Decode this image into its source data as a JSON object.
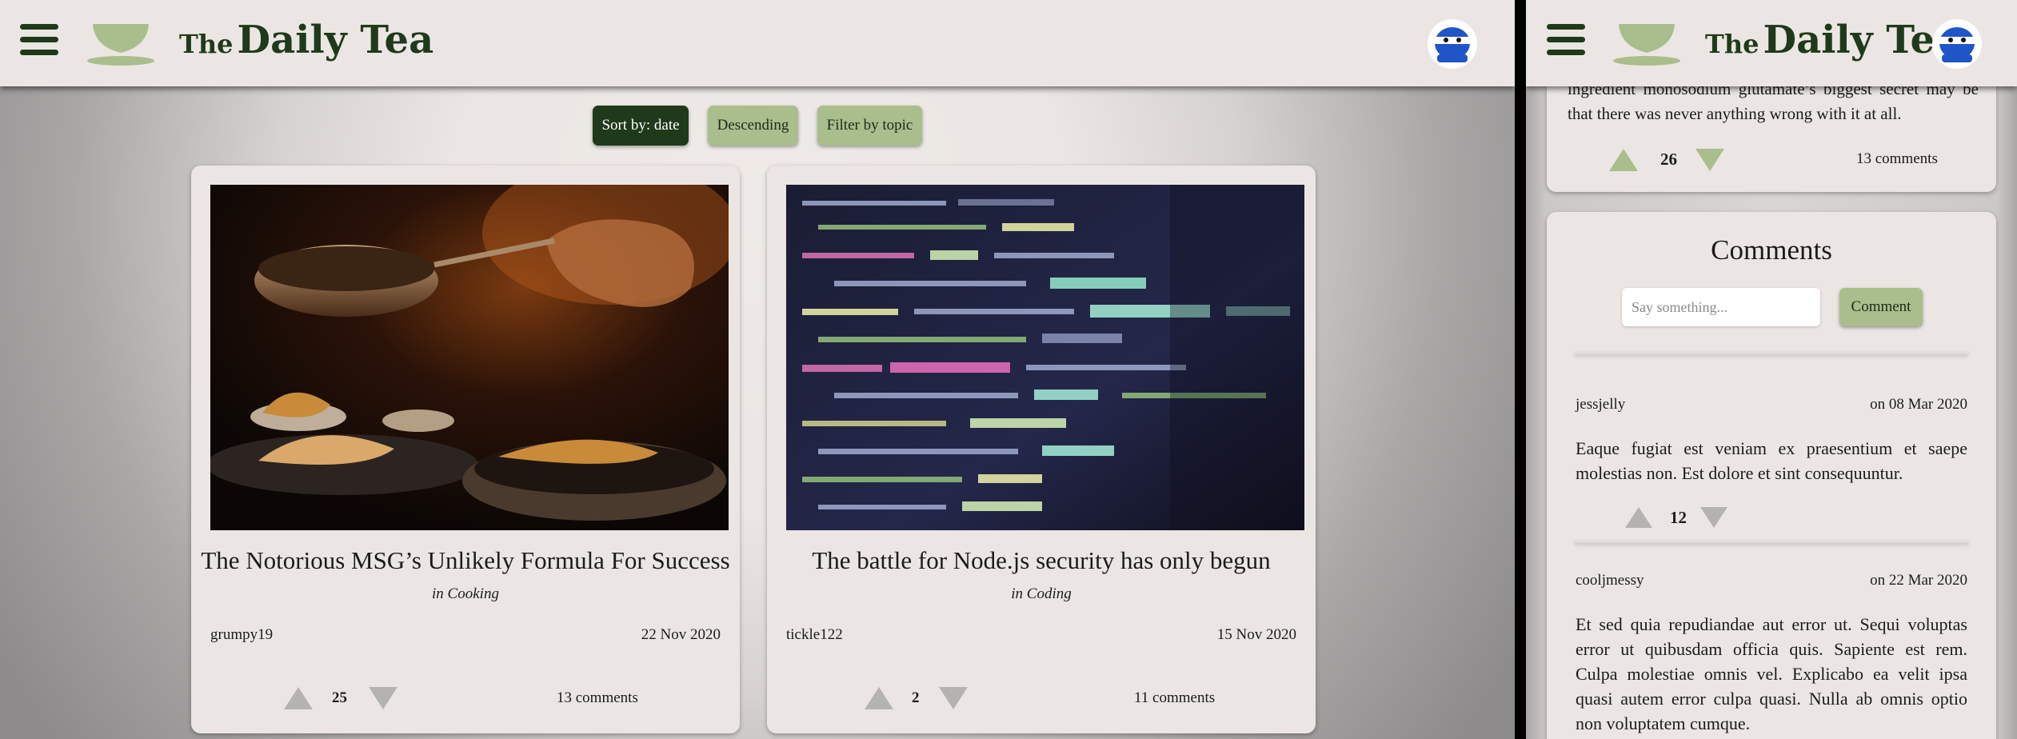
{
  "app": {
    "brand_the": "The",
    "brand_name": "Daily Tea"
  },
  "toolbar": {
    "sort_label": "Sort by: date",
    "order_label": "Descending",
    "filter_label": "Filter by topic"
  },
  "articles": [
    {
      "title": "The Notorious MSG’s Unlikely Formula For Success",
      "topic": "in Cooking",
      "author": "grumpy19",
      "date": "22 Nov 2020",
      "score": "25",
      "comments": "13 comments",
      "image": "cooking-photo"
    },
    {
      "title": "The battle for Node.js security has only begun",
      "topic": "in Coding",
      "author": "tickle122",
      "date": "15 Nov 2020",
      "score": "2",
      "comments": "11 comments",
      "image": "code-screen-photo"
    }
  ],
  "detail": {
    "excerpt": "ingredient monosodium glutamate’s biggest secret may be that there was never anything wrong with it at all.",
    "score": "26",
    "comments": "13 comments",
    "comments_heading": "Comments",
    "input_placeholder": "Say something...",
    "comment_button": "Comment",
    "comment_list": [
      {
        "author": "jessjelly",
        "date": "on 08 Mar 2020",
        "body": "Eaque fugiat est veniam ex praesentium et saepe molestias non. Est dolore et sint consequuntur.",
        "score": "12"
      },
      {
        "author": "cooljmessy",
        "date": "on 22 Mar 2020",
        "body": "Et sed quia repudiandae aut error ut. Sequi voluptas error ut quibusdam officia quis. Sapiente est rem. Culpa molestiae omnis vel. Explicabo ea velit ipsa quasi autem error culpa quasi. Nulla ab omnis optio non voluptatem cumque."
      }
    ]
  },
  "colors": {
    "brand_green": "#1f3a1a",
    "accent_green": "#a9be8c",
    "surface": "#ebe6e3",
    "vote_grey": "#b5b3b0"
  }
}
